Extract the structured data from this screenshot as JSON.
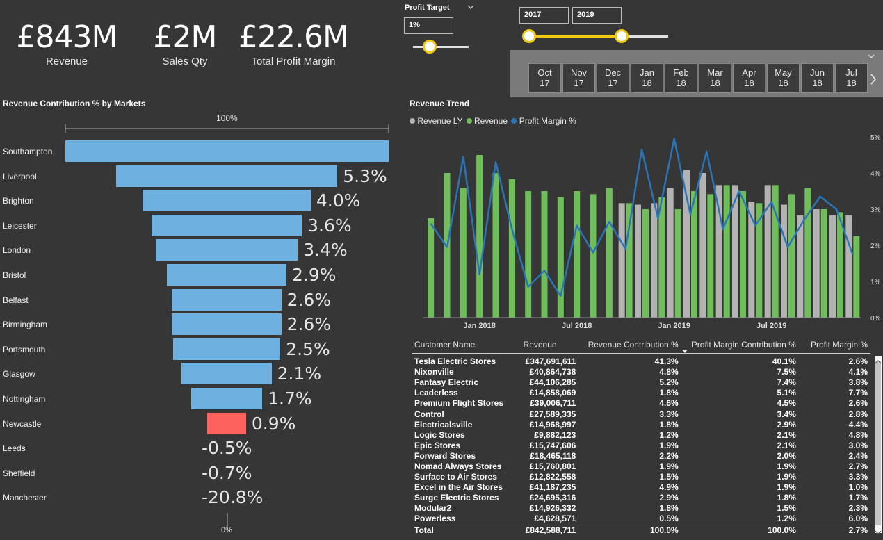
{
  "kpis": [
    {
      "value": "£843M",
      "label": "Revenue"
    },
    {
      "value": "£2M",
      "label": "Sales Qty"
    },
    {
      "value": "£22.6M",
      "label": "Total Profit Margin"
    }
  ],
  "profit_target": {
    "title": "Profit Target",
    "value": "1%",
    "slider_level": 0.4
  },
  "year_range": {
    "from": "2017",
    "to": "2019"
  },
  "months": [
    {
      "m": "Oct",
      "y": "17"
    },
    {
      "m": "Nov",
      "y": "17"
    },
    {
      "m": "Dec",
      "y": "17"
    },
    {
      "m": "Jan",
      "y": "18"
    },
    {
      "m": "Feb",
      "y": "18"
    },
    {
      "m": "Mar",
      "y": "18"
    },
    {
      "m": "Apr",
      "y": "18"
    },
    {
      "m": "May",
      "y": "18"
    },
    {
      "m": "Jun",
      "y": "18"
    },
    {
      "m": "Jul",
      "y": "18"
    }
  ],
  "icons": {
    "chevron_down": "chevron-down-icon",
    "chevron_right": "chevron-right-icon",
    "sort_down": "sort-down-icon"
  },
  "funnel": {
    "title": "Revenue Contribution % by Markets",
    "top_label": "100%",
    "bottom_label": "0%",
    "colors": {
      "bar": "#6eb1e1",
      "negative_highlight": "#fd625e"
    },
    "markets": [
      {
        "name": "Southampton",
        "value": null,
        "label": "",
        "rel": 1.0
      },
      {
        "name": "Liverpool",
        "value": 5.3,
        "label": "5.3%",
        "rel": 0.685
      },
      {
        "name": "Brighton",
        "value": 4.0,
        "label": "4.0%",
        "rel": 0.52
      },
      {
        "name": "Leicester",
        "value": 3.6,
        "label": "3.6%",
        "rel": 0.465
      },
      {
        "name": "London",
        "value": 3.4,
        "label": "3.4%",
        "rel": 0.44
      },
      {
        "name": "Bristol",
        "value": 2.9,
        "label": "2.9%",
        "rel": 0.37
      },
      {
        "name": "Belfast",
        "value": 2.6,
        "label": "2.6%",
        "rel": 0.338
      },
      {
        "name": "Birmingham",
        "value": 2.6,
        "label": "2.6%",
        "rel": 0.338
      },
      {
        "name": "Portsmouth",
        "value": 2.5,
        "label": "2.5%",
        "rel": 0.332
      },
      {
        "name": "Glasgow",
        "value": 2.1,
        "label": "2.1%",
        "rel": 0.278
      },
      {
        "name": "Nottingham",
        "value": 1.7,
        "label": "1.7%",
        "rel": 0.22
      },
      {
        "name": "Newcastle",
        "value": 0.9,
        "label": "0.9%",
        "rel": 0.12,
        "highlight": true
      },
      {
        "name": "Leeds",
        "value": -0.5,
        "label": "-0.5%",
        "rel": 0
      },
      {
        "name": "Sheffield",
        "value": -0.7,
        "label": "-0.7%",
        "rel": 0
      },
      {
        "name": "Manchester",
        "value": -20.8,
        "label": "-20.8%",
        "rel": 0
      }
    ]
  },
  "chart_data": {
    "type": "bar",
    "title": "Revenue Trend",
    "legend": [
      "Revenue LY",
      "Revenue",
      "Profit Margin %"
    ],
    "legend_position": "top-left",
    "colors": {
      "revenue_ly": "#b3b3b3",
      "revenue": "#6fbe5b",
      "profit_margin": "#2a75b8"
    },
    "x_tick_labels": [
      "Jan 2018",
      "Jul 2018",
      "Jan 2019",
      "Jul 2019"
    ],
    "x_tick_index": [
      3,
      9,
      15,
      21
    ],
    "y2_ticks": [
      "0%",
      "1%",
      "2%",
      "3%",
      "4%",
      "5%"
    ],
    "y2_range": [
      0,
      5
    ],
    "months": [
      "Oct 2017",
      "Nov 2017",
      "Dec 2017",
      "Jan 2018",
      "Feb 2018",
      "Mar 2018",
      "Apr 2018",
      "May 2018",
      "Jun 2018",
      "Jul 2018",
      "Aug 2018",
      "Sep 2018",
      "Oct 2018",
      "Nov 2018",
      "Dec 2018",
      "Jan 2019",
      "Feb 2019",
      "Mar 2019",
      "Apr 2019",
      "May 2019",
      "Jun 2019",
      "Jul 2019",
      "Aug 2019",
      "Sep 2019",
      "Oct 2019",
      "Nov 2019",
      "Dec 2019"
    ],
    "revenue_ly": [
      null,
      null,
      null,
      null,
      null,
      null,
      null,
      null,
      null,
      null,
      null,
      null,
      38,
      37.5,
      38,
      43,
      49,
      48,
      44,
      44,
      38.5,
      44,
      37.5,
      34,
      36,
      34,
      34
    ],
    "revenue": [
      33,
      48,
      43,
      54,
      48,
      46,
      42,
      42,
      40,
      42,
      41,
      43,
      38,
      36,
      40,
      36,
      42,
      41,
      44,
      42,
      38,
      44,
      41,
      43,
      36,
      35,
      27
    ],
    "profit_margin_pct": [
      2.6,
      1.95,
      4.45,
      1.2,
      4.3,
      2.45,
      0.85,
      1.3,
      0.6,
      2.55,
      1.8,
      2.65,
      1.9,
      4.65,
      2.75,
      4.95,
      2.85,
      4.6,
      2.45,
      3.5,
      2.55,
      3.2,
      1.95,
      2.7,
      3.35,
      3.0,
      1.75
    ]
  },
  "table": {
    "columns": [
      "Customer Name",
      "Revenue",
      "Revenue Contribution %",
      "Profit Margin Contribution %",
      "Profit Margin %"
    ],
    "rows": [
      [
        "Tesla Electric Stores",
        "£347,691,611",
        "41.3%",
        "40.1%",
        "2.6%"
      ],
      [
        "Nixonville",
        "£40,864,738",
        "4.8%",
        "7.5%",
        "4.1%"
      ],
      [
        "Fantasy Electric",
        "£44,106,285",
        "5.2%",
        "7.4%",
        "3.8%"
      ],
      [
        "Leaderless",
        "£14,858,069",
        "1.8%",
        "5.1%",
        "7.7%"
      ],
      [
        "Premium Flight Stores",
        "£39,006,711",
        "4.6%",
        "4.5%",
        "2.6%"
      ],
      [
        "Control",
        "£27,589,335",
        "3.3%",
        "3.4%",
        "2.8%"
      ],
      [
        "Electricalsville",
        "£14,968,997",
        "1.8%",
        "2.9%",
        "4.4%"
      ],
      [
        "Logic Stores",
        "£9,882,123",
        "1.2%",
        "2.1%",
        "4.8%"
      ],
      [
        "Epic Stores",
        "£15,747,606",
        "1.9%",
        "2.1%",
        "3.0%"
      ],
      [
        "Forward Stores",
        "£18,465,118",
        "2.2%",
        "2.0%",
        "2.4%"
      ],
      [
        "Nomad Always Stores",
        "£15,760,801",
        "1.9%",
        "1.9%",
        "2.7%"
      ],
      [
        "Surface to Air Stores",
        "£12,822,558",
        "1.5%",
        "1.9%",
        "3.3%"
      ],
      [
        "Excel in the Air Stores",
        "£41,187,235",
        "4.9%",
        "1.9%",
        "1.0%"
      ],
      [
        "Surge Electric Stores",
        "£24,695,316",
        "2.9%",
        "1.8%",
        "1.7%"
      ],
      [
        "Modular2",
        "£14,926,332",
        "1.8%",
        "1.5%",
        "2.3%"
      ],
      [
        "Powerless",
        "£4,628,571",
        "0.5%",
        "1.2%",
        "6.0%"
      ]
    ],
    "total": [
      "Total",
      "£842,588,711",
      "100.0%",
      "100.0%",
      "2.7%"
    ]
  }
}
